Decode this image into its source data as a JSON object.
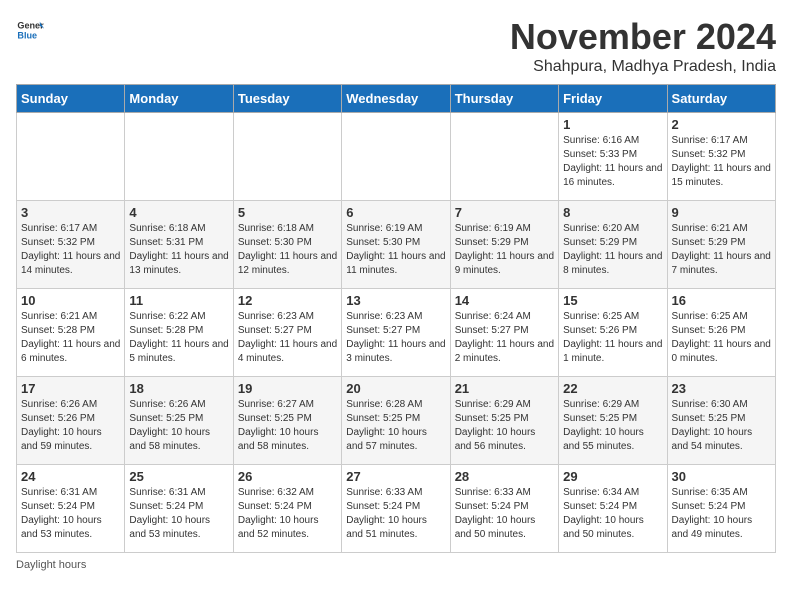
{
  "logo": {
    "line1": "General",
    "line2": "Blue"
  },
  "title": "November 2024",
  "location": "Shahpura, Madhya Pradesh, India",
  "days_of_week": [
    "Sunday",
    "Monday",
    "Tuesday",
    "Wednesday",
    "Thursday",
    "Friday",
    "Saturday"
  ],
  "weeks": [
    [
      {
        "num": "",
        "info": ""
      },
      {
        "num": "",
        "info": ""
      },
      {
        "num": "",
        "info": ""
      },
      {
        "num": "",
        "info": ""
      },
      {
        "num": "",
        "info": ""
      },
      {
        "num": "1",
        "info": "Sunrise: 6:16 AM\nSunset: 5:33 PM\nDaylight: 11 hours and 16 minutes."
      },
      {
        "num": "2",
        "info": "Sunrise: 6:17 AM\nSunset: 5:32 PM\nDaylight: 11 hours and 15 minutes."
      }
    ],
    [
      {
        "num": "3",
        "info": "Sunrise: 6:17 AM\nSunset: 5:32 PM\nDaylight: 11 hours and 14 minutes."
      },
      {
        "num": "4",
        "info": "Sunrise: 6:18 AM\nSunset: 5:31 PM\nDaylight: 11 hours and 13 minutes."
      },
      {
        "num": "5",
        "info": "Sunrise: 6:18 AM\nSunset: 5:30 PM\nDaylight: 11 hours and 12 minutes."
      },
      {
        "num": "6",
        "info": "Sunrise: 6:19 AM\nSunset: 5:30 PM\nDaylight: 11 hours and 11 minutes."
      },
      {
        "num": "7",
        "info": "Sunrise: 6:19 AM\nSunset: 5:29 PM\nDaylight: 11 hours and 9 minutes."
      },
      {
        "num": "8",
        "info": "Sunrise: 6:20 AM\nSunset: 5:29 PM\nDaylight: 11 hours and 8 minutes."
      },
      {
        "num": "9",
        "info": "Sunrise: 6:21 AM\nSunset: 5:29 PM\nDaylight: 11 hours and 7 minutes."
      }
    ],
    [
      {
        "num": "10",
        "info": "Sunrise: 6:21 AM\nSunset: 5:28 PM\nDaylight: 11 hours and 6 minutes."
      },
      {
        "num": "11",
        "info": "Sunrise: 6:22 AM\nSunset: 5:28 PM\nDaylight: 11 hours and 5 minutes."
      },
      {
        "num": "12",
        "info": "Sunrise: 6:23 AM\nSunset: 5:27 PM\nDaylight: 11 hours and 4 minutes."
      },
      {
        "num": "13",
        "info": "Sunrise: 6:23 AM\nSunset: 5:27 PM\nDaylight: 11 hours and 3 minutes."
      },
      {
        "num": "14",
        "info": "Sunrise: 6:24 AM\nSunset: 5:27 PM\nDaylight: 11 hours and 2 minutes."
      },
      {
        "num": "15",
        "info": "Sunrise: 6:25 AM\nSunset: 5:26 PM\nDaylight: 11 hours and 1 minute."
      },
      {
        "num": "16",
        "info": "Sunrise: 6:25 AM\nSunset: 5:26 PM\nDaylight: 11 hours and 0 minutes."
      }
    ],
    [
      {
        "num": "17",
        "info": "Sunrise: 6:26 AM\nSunset: 5:26 PM\nDaylight: 10 hours and 59 minutes."
      },
      {
        "num": "18",
        "info": "Sunrise: 6:26 AM\nSunset: 5:25 PM\nDaylight: 10 hours and 58 minutes."
      },
      {
        "num": "19",
        "info": "Sunrise: 6:27 AM\nSunset: 5:25 PM\nDaylight: 10 hours and 58 minutes."
      },
      {
        "num": "20",
        "info": "Sunrise: 6:28 AM\nSunset: 5:25 PM\nDaylight: 10 hours and 57 minutes."
      },
      {
        "num": "21",
        "info": "Sunrise: 6:29 AM\nSunset: 5:25 PM\nDaylight: 10 hours and 56 minutes."
      },
      {
        "num": "22",
        "info": "Sunrise: 6:29 AM\nSunset: 5:25 PM\nDaylight: 10 hours and 55 minutes."
      },
      {
        "num": "23",
        "info": "Sunrise: 6:30 AM\nSunset: 5:25 PM\nDaylight: 10 hours and 54 minutes."
      }
    ],
    [
      {
        "num": "24",
        "info": "Sunrise: 6:31 AM\nSunset: 5:24 PM\nDaylight: 10 hours and 53 minutes."
      },
      {
        "num": "25",
        "info": "Sunrise: 6:31 AM\nSunset: 5:24 PM\nDaylight: 10 hours and 53 minutes."
      },
      {
        "num": "26",
        "info": "Sunrise: 6:32 AM\nSunset: 5:24 PM\nDaylight: 10 hours and 52 minutes."
      },
      {
        "num": "27",
        "info": "Sunrise: 6:33 AM\nSunset: 5:24 PM\nDaylight: 10 hours and 51 minutes."
      },
      {
        "num": "28",
        "info": "Sunrise: 6:33 AM\nSunset: 5:24 PM\nDaylight: 10 hours and 50 minutes."
      },
      {
        "num": "29",
        "info": "Sunrise: 6:34 AM\nSunset: 5:24 PM\nDaylight: 10 hours and 50 minutes."
      },
      {
        "num": "30",
        "info": "Sunrise: 6:35 AM\nSunset: 5:24 PM\nDaylight: 10 hours and 49 minutes."
      }
    ]
  ],
  "footer": "Daylight hours"
}
